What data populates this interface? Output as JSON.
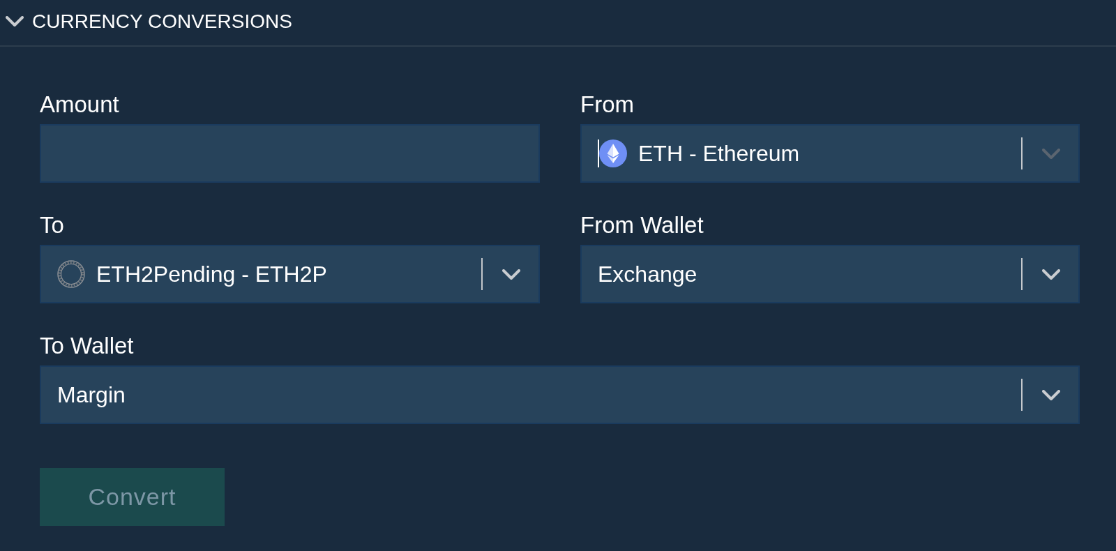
{
  "panel": {
    "title": "CURRENCY CONVERSIONS",
    "expanded": true
  },
  "form": {
    "amount": {
      "label": "Amount"
    },
    "from": {
      "label": "From",
      "value": "ETH - Ethereum",
      "focused": true
    },
    "to": {
      "label": "To",
      "value": "ETH2Pending - ETH2P",
      "focused": false
    },
    "from_wallet": {
      "label": "From Wallet",
      "value": "Exchange",
      "focused": false
    },
    "to_wallet": {
      "label": "To Wallet",
      "value": "Margin",
      "focused": false
    }
  },
  "convert_button": {
    "label": "Convert",
    "disabled": true
  }
}
